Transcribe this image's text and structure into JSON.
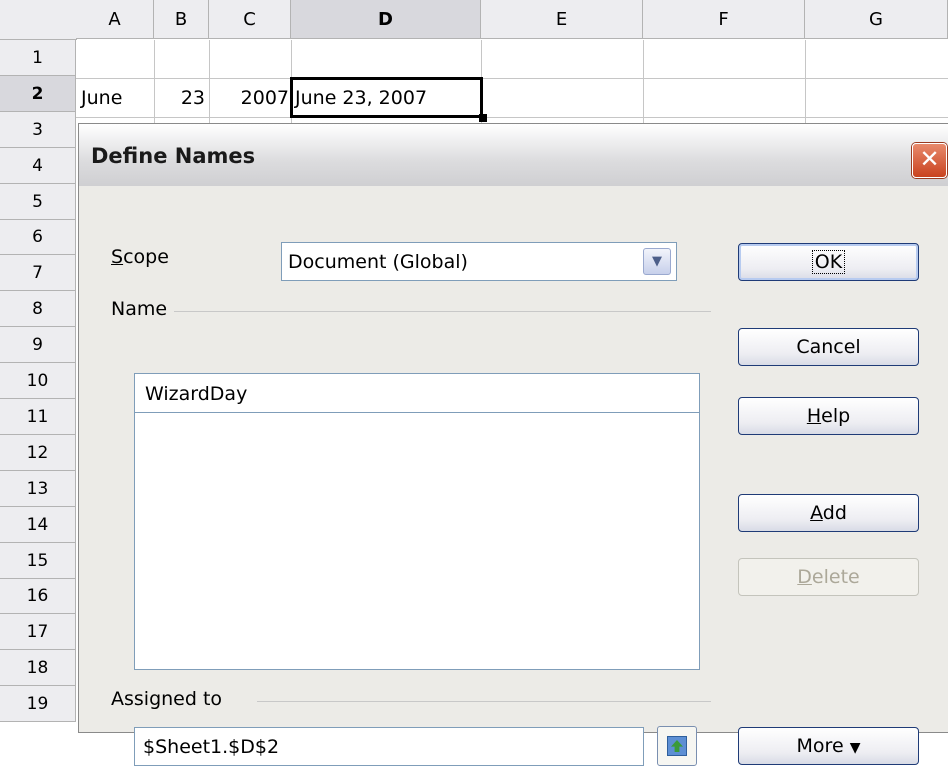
{
  "spreadsheet": {
    "columns": [
      "A",
      "B",
      "C",
      "D",
      "E",
      "F",
      "G"
    ],
    "active_column": "D",
    "rows": [
      "1",
      "2",
      "3",
      "4",
      "5",
      "6",
      "7",
      "8",
      "9",
      "10",
      "11",
      "12",
      "13",
      "14",
      "15",
      "16",
      "17",
      "18",
      "19"
    ],
    "active_row": "2",
    "row2": {
      "A": "June",
      "B": "23",
      "C": "2007",
      "D": "June 23, 2007"
    }
  },
  "dialog": {
    "title": "Define Names",
    "close_glyph": "✕",
    "scope_label_u": "S",
    "scope_label_rest": "cope",
    "scope_value": "Document (Global)",
    "name_section": "Name",
    "name_value": "WizardDay",
    "assigned_section": "Assigned to",
    "assigned_value": "$Sheet1.$D$2",
    "buttons": {
      "ok": "OK",
      "cancel": "Cancel",
      "help_u": "H",
      "help_rest": "elp",
      "add_u": "A",
      "add_rest": "dd",
      "delete_u": "D",
      "delete_rest": "elete",
      "more": "More",
      "more_icon": "▼"
    }
  },
  "colors": {
    "dialog_bg": "#ecebe7",
    "button_border": "#1f3b77",
    "close_red": "#c9421f"
  },
  "icons": [
    "close-icon",
    "dropdown-arrow-icon",
    "shrink-icon",
    "more-arrow-icon"
  ]
}
